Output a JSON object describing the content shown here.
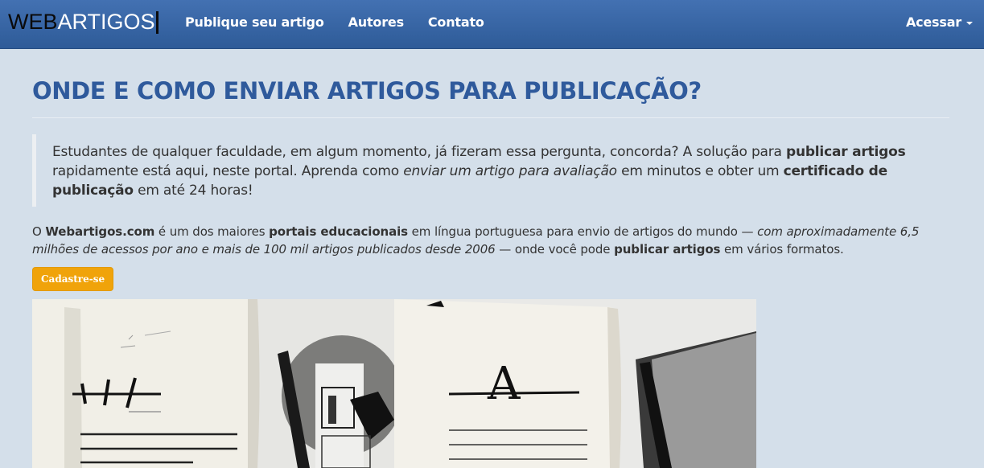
{
  "navbar": {
    "logo_part1": "WEB",
    "logo_part2": "ARTIGOS",
    "links": [
      "Publique seu artigo",
      "Autores",
      "Contato"
    ],
    "login_label": "Acessar"
  },
  "main": {
    "title": "ONDE E COMO ENVIAR ARTIGOS PARA PUBLICAÇÃO?",
    "quote": {
      "t1": "Estudantes de qualquer faculdade, em algum momento, já fizeram essa pergunta, concorda? A solução para ",
      "b1": "publicar artigos",
      "t2": " rapidamente está aqui, neste portal. Aprenda como ",
      "i1": "enviar um artigo para avaliação",
      "t3": " em minutos e obter um ",
      "b2": "certificado de publicação",
      "t4": " em até 24 horas!"
    },
    "para": {
      "t1": "O ",
      "b1": "Webartigos.com",
      "t2": " é um dos maiores ",
      "b2": "portais educacionais",
      "t3": " em língua portuguesa para envio de artigos do mundo — ",
      "i1": "com aproximadamente 6,5 milhões de acessos por ano e mais de 100 mil artigos publicados desde 2006",
      "t4": " — onde você pode ",
      "b3": "publicar artigos",
      "t5": " em vários formatos."
    },
    "cta_label": "Cadastre-se",
    "hero_letter": "A"
  }
}
